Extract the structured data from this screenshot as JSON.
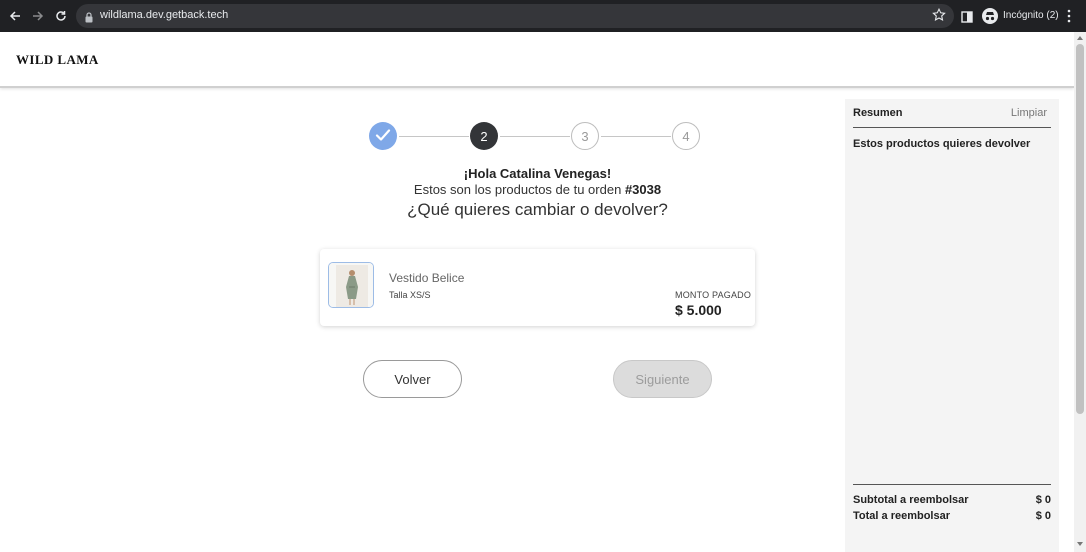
{
  "browser": {
    "url": "wildlama.dev.getback.tech",
    "profile_label": "Incógnito (2)"
  },
  "header": {
    "logo": "WILD LAMA"
  },
  "stepper": {
    "steps": [
      {
        "label": "",
        "state": "done"
      },
      {
        "label": "2",
        "state": "active"
      },
      {
        "label": "3",
        "state": "todo"
      },
      {
        "label": "4",
        "state": "todo"
      }
    ]
  },
  "greeting": {
    "hello": "¡Hola Catalina Venegas!",
    "products_prefix": "Estos son los productos de tu orden",
    "order_number": "#3038",
    "question": "¿Qué quieres cambiar o devolver?"
  },
  "product": {
    "name": "Vestido Belice",
    "size": "Talla XS/S",
    "paid_label": "MONTO PAGADO",
    "paid_value": "$ 5.000"
  },
  "buttons": {
    "back": "Volver",
    "next": "Siguiente"
  },
  "summary": {
    "title": "Resumen",
    "clear": "Limpiar",
    "subtitle": "Estos productos quieres devolver",
    "subtotal_label": "Subtotal a reembolsar",
    "subtotal_value": "$ 0",
    "total_label": "Total a reembolsar",
    "total_value": "$ 0"
  },
  "colors": {
    "step_done": "#7fa8e8",
    "step_active": "#333538",
    "chrome_bg": "#202124"
  },
  "icons": [
    "back-arrow-icon",
    "forward-arrow-icon",
    "reload-icon",
    "lock-icon",
    "star-icon",
    "side-panel-icon",
    "incognito-avatar-icon",
    "kebab-menu-icon",
    "checkmark-icon"
  ]
}
